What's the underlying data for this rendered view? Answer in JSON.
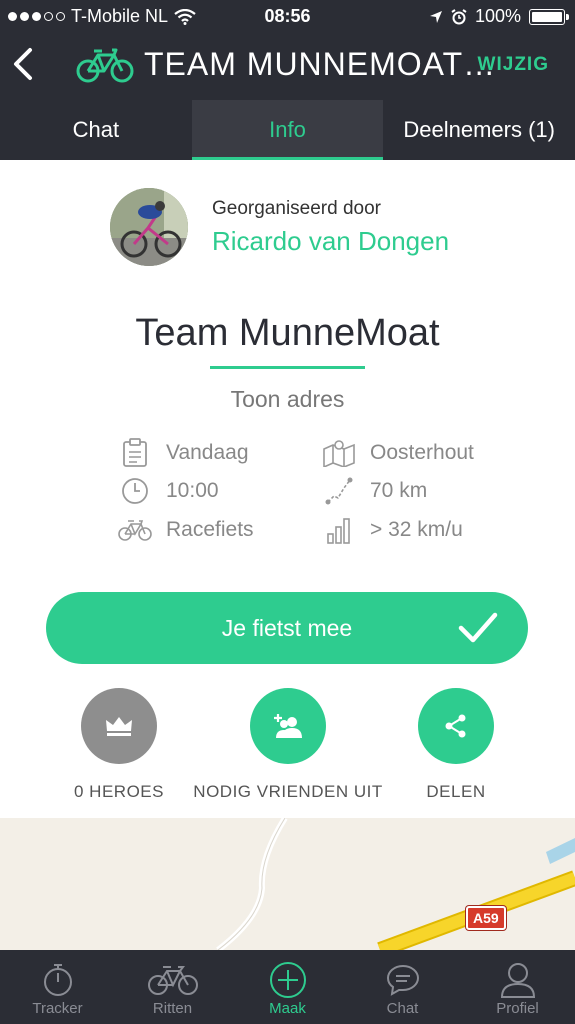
{
  "status_bar": {
    "carrier": "T-Mobile NL",
    "time": "08:56",
    "battery": "100%"
  },
  "header": {
    "title": "TEAM MUNNEMOAT…",
    "edit_label": "WIJZIG"
  },
  "tabs": [
    {
      "label": "Chat",
      "active": false
    },
    {
      "label": "Info",
      "active": true
    },
    {
      "label": "Deelnemers (1)",
      "active": false
    }
  ],
  "organizer": {
    "subtitle": "Georganiseerd door",
    "name": "Ricardo van Dongen"
  },
  "ride": {
    "title": "Team MunneMoat",
    "address_toggle": "Toon adres",
    "date": "Vandaag",
    "time": "10:00",
    "bike_type": "Racefiets",
    "location": "Oosterhout",
    "distance": "70 km",
    "speed": "> 32 km/u"
  },
  "cta": {
    "label": "Je fietst mee"
  },
  "actions": [
    {
      "label": "0 HEROES",
      "icon": "crown-icon"
    },
    {
      "label": "NODIG VRIENDEN UIT",
      "icon": "add-friends-icon"
    },
    {
      "label": "DELEN",
      "icon": "share-icon"
    }
  ],
  "map": {
    "road_label": "A59"
  },
  "bottom_nav": [
    {
      "label": "Tracker",
      "icon": "stopwatch-icon"
    },
    {
      "label": "Ritten",
      "icon": "bicycle-icon"
    },
    {
      "label": "Maak",
      "icon": "plus-circle-icon",
      "active": true
    },
    {
      "label": "Chat",
      "icon": "chat-bubble-icon"
    },
    {
      "label": "Profiel",
      "icon": "person-icon"
    }
  ],
  "colors": {
    "accent": "#2ecc8f",
    "header_bg": "#2b2d35",
    "hero_gray": "#8e8e8e"
  }
}
